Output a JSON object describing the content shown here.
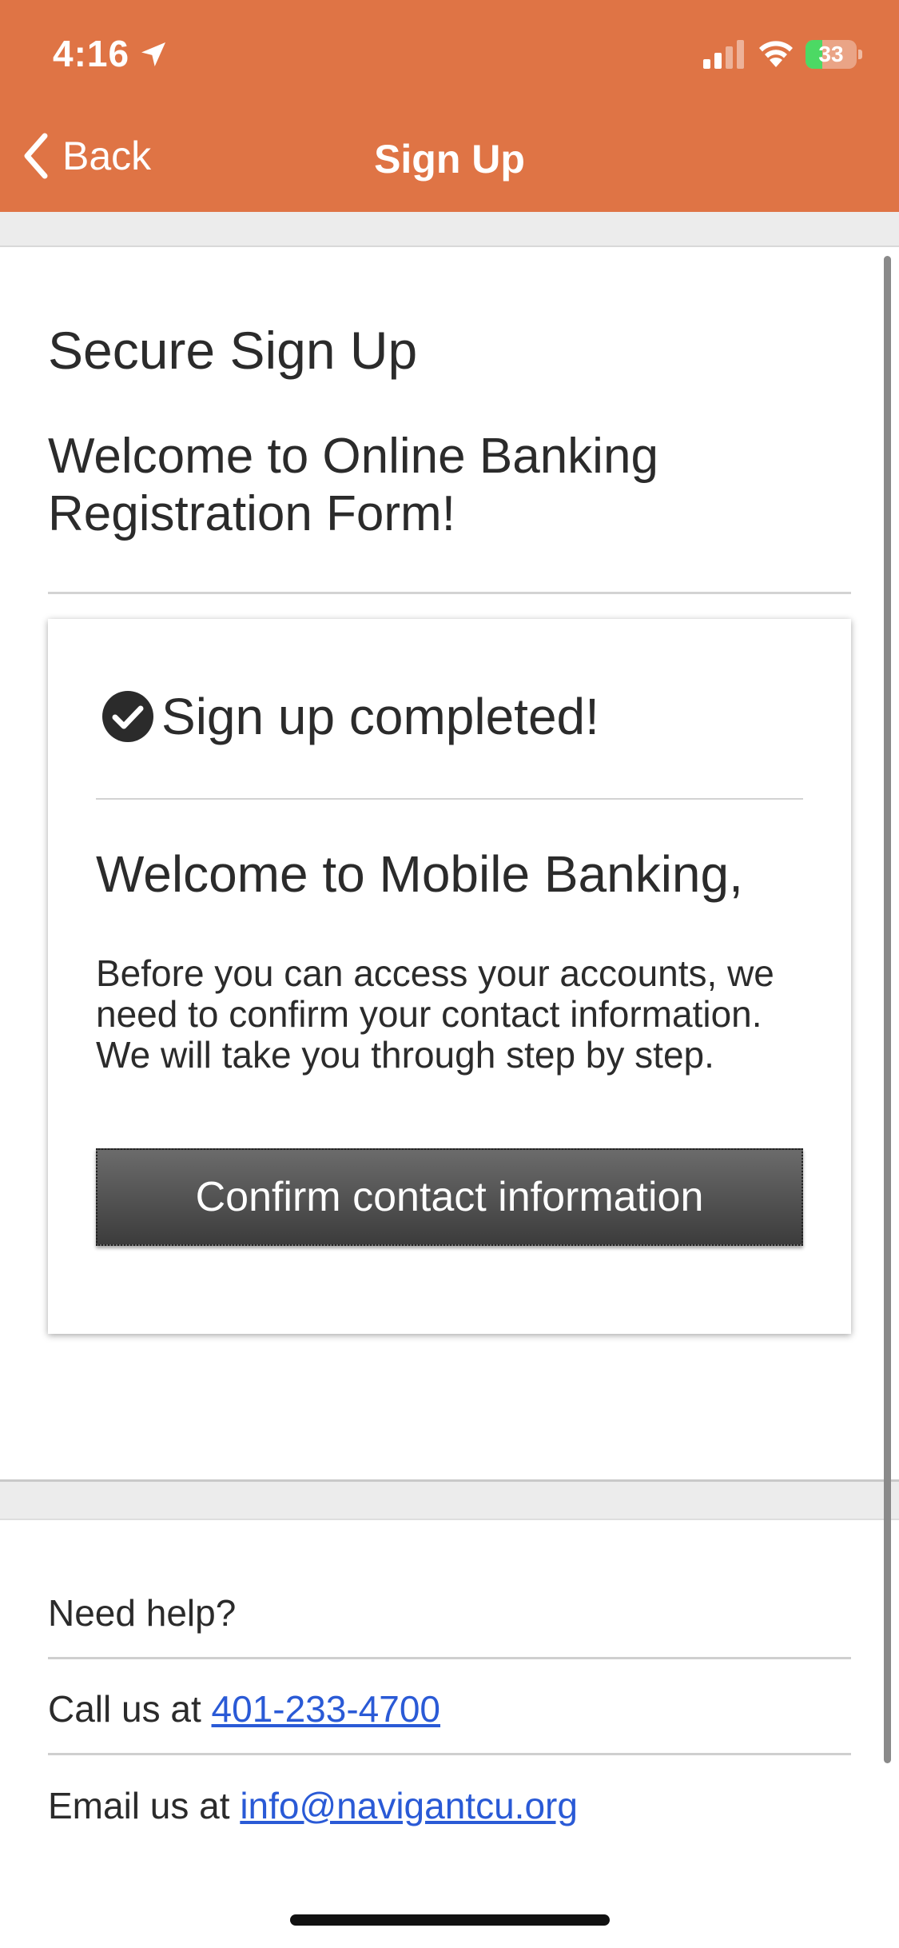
{
  "status_bar": {
    "time": "4:16",
    "battery_level": "33",
    "battery_fill_fraction": 0.33,
    "icons": [
      "location-arrow-icon",
      "cellular-signal-icon",
      "wifi-icon",
      "battery-charging-icon"
    ]
  },
  "nav": {
    "back_label": "Back",
    "title": "Sign Up",
    "background_color": "#df7445"
  },
  "page": {
    "title": "Secure Sign Up",
    "welcome_heading": "Welcome to Online Banking Registration Form!"
  },
  "card": {
    "success_icon": "check-circle-icon",
    "success_text": "Sign up completed!",
    "heading": "Welcome to Mobile Banking,",
    "body": "Before you can access your accounts, we need to confirm your contact information. We will take you through step by step.",
    "button_label": "Confirm contact information"
  },
  "footer": {
    "help_text": "Need help?",
    "call_prefix": "Call us at ",
    "phone": "401-233-4700",
    "email_prefix": "Email us at ",
    "email": "info@navigantcu.org",
    "link_color": "#2a5ad6"
  }
}
